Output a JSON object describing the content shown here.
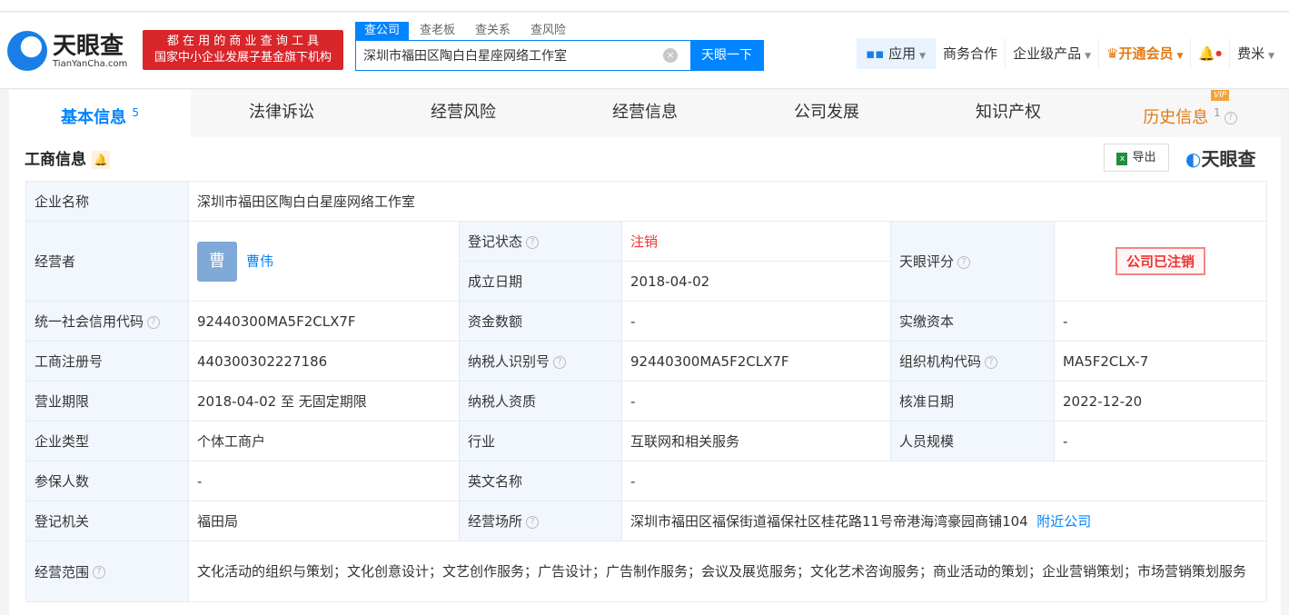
{
  "header": {
    "logo_cn": "天眼查",
    "logo_en": "TianYanCha.com",
    "slogan1": "都 在 用 的 商 业 查 询 工 具",
    "slogan2": "国家中小企业发展子基金旗下机构",
    "search_tabs": [
      "查公司",
      "查老板",
      "查关系",
      "查风险"
    ],
    "search_value": "深圳市福田区陶白白星座网络工作室",
    "search_button": "天眼一下",
    "nav": {
      "app": "应用",
      "business": "商务合作",
      "enterprise": "企业级产品",
      "vip": "开通会员",
      "user": "费米"
    }
  },
  "tabs": [
    {
      "label": "基本信息",
      "count": "5"
    },
    {
      "label": "法律诉讼"
    },
    {
      "label": "经营风险"
    },
    {
      "label": "经营信息"
    },
    {
      "label": "公司发展"
    },
    {
      "label": "知识产权"
    },
    {
      "label": "历史信息",
      "count": "1",
      "badge": "VIP"
    }
  ],
  "section": {
    "title": "工商信息",
    "export": "导出",
    "watermark": "天眼查"
  },
  "info": {
    "company_name_label": "企业名称",
    "company_name": "深圳市福田区陶白白星座网络工作室",
    "operator_label": "经营者",
    "operator_avatar": "曹",
    "operator": "曹伟",
    "status_label": "登记状态",
    "status": "注销",
    "founded_label": "成立日期",
    "founded": "2018-04-02",
    "score_label": "天眼评分",
    "score_stamp": "公司已注销",
    "credit_code_label": "统一社会信用代码",
    "credit_code": "92440300MA5F2CLX7F",
    "capital_label": "资金数额",
    "capital": "-",
    "paid_label": "实缴资本",
    "paid": "-",
    "reg_no_label": "工商注册号",
    "reg_no": "440300302227186",
    "tax_id_label": "纳税人识别号",
    "tax_id": "92440300MA5F2CLX7F",
    "org_code_label": "组织机构代码",
    "org_code": "MA5F2CLX-7",
    "term_label": "营业期限",
    "term": "2018-04-02 至 无固定期限",
    "taxpayer_label": "纳税人资质",
    "taxpayer": "-",
    "approve_label": "核准日期",
    "approve": "2022-12-20",
    "type_label": "企业类型",
    "type": "个体工商户",
    "industry_label": "行业",
    "industry": "互联网和相关服务",
    "staff_label": "人员规模",
    "staff": "-",
    "insured_label": "参保人数",
    "insured": "-",
    "en_name_label": "英文名称",
    "en_name": "-",
    "authority_label": "登记机关",
    "authority": "福田局",
    "address_label": "经营场所",
    "address": "深圳市福田区福保街道福保社区桂花路11号帝港海湾豪园商铺104",
    "nearby": "附近公司",
    "scope_label": "经营范围",
    "scope": "文化活动的组织与策划；文化创意设计；文艺创作服务；广告设计；广告制作服务；会议及展览服务；文化艺术咨询服务；商业活动的策划；企业营销策划；市场营销策划服务"
  }
}
